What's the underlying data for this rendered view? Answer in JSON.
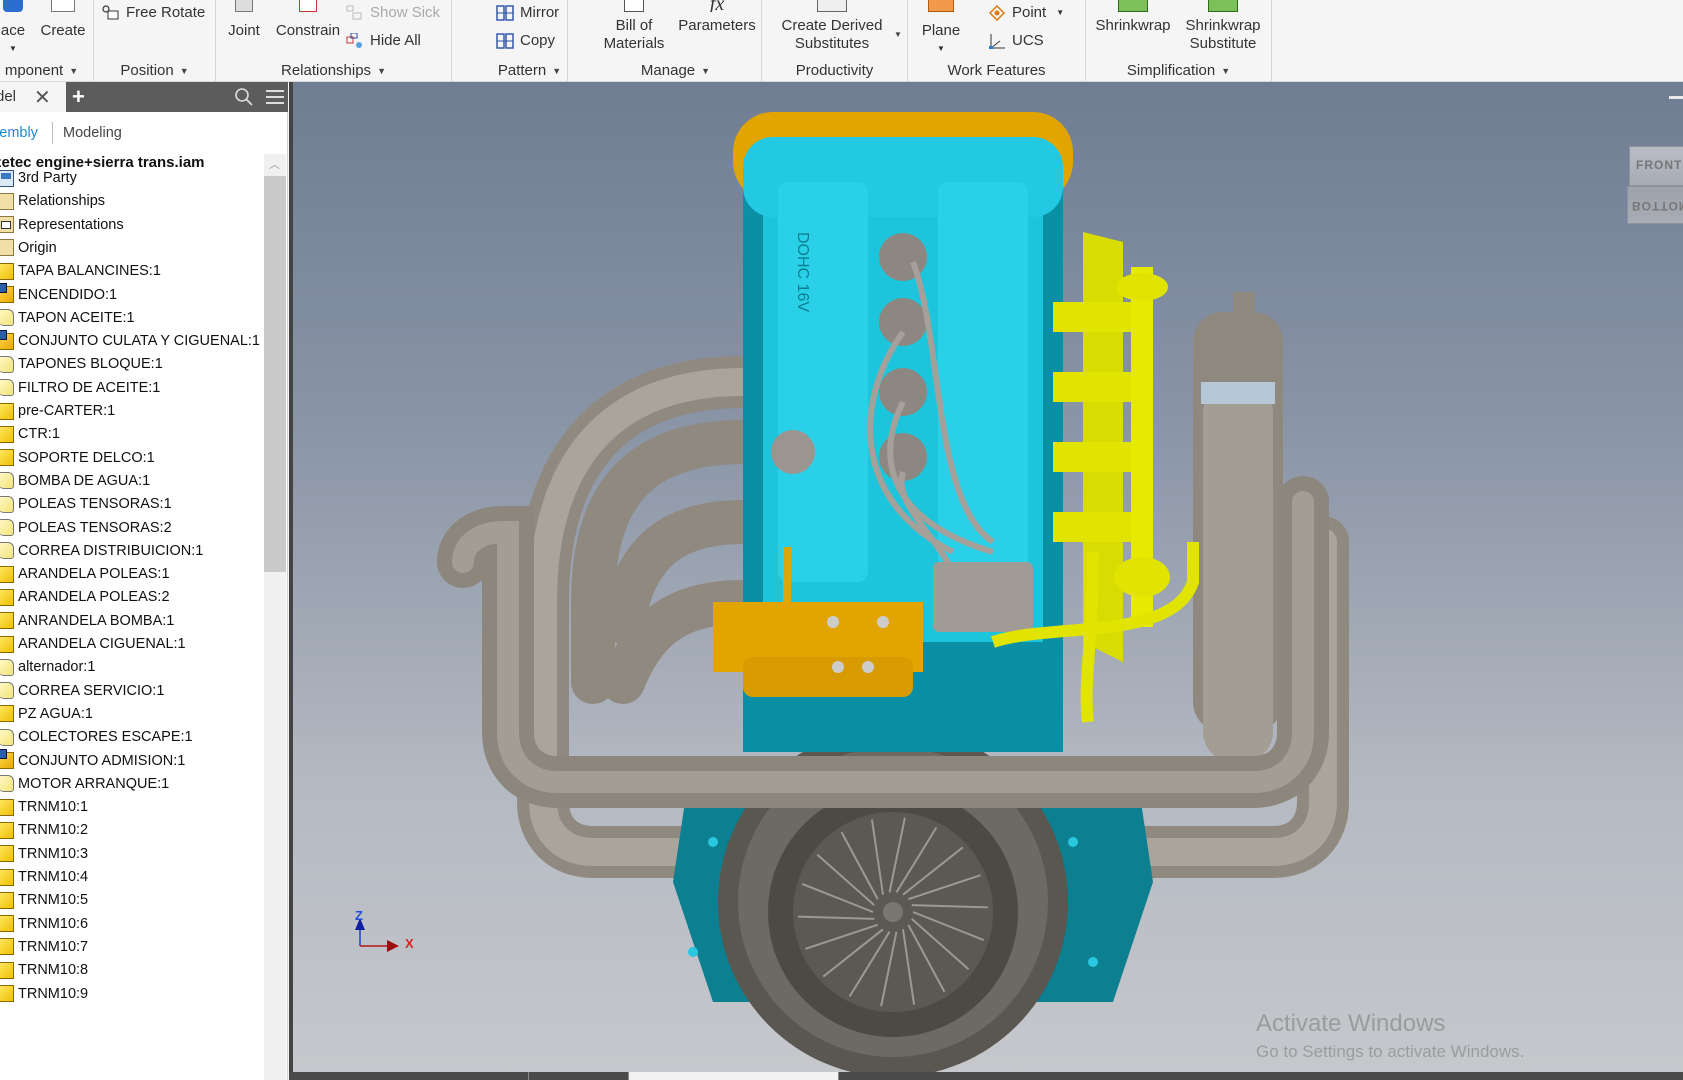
{
  "ribbon": {
    "panels": [
      {
        "title": "mponent",
        "buttons": [
          {
            "label": "ace"
          },
          {
            "label": "Create"
          }
        ]
      },
      {
        "title": "Position",
        "buttons": [
          {
            "label": "Free Rotate"
          }
        ]
      },
      {
        "title": "Relationships",
        "buttons": [
          {
            "label": "Joint"
          },
          {
            "label": "Constrain"
          },
          {
            "label": "Show Sick"
          },
          {
            "label": "Hide All"
          }
        ]
      },
      {
        "title": "Pattern",
        "buttons": [
          {
            "label": "Mirror"
          },
          {
            "label": "Copy"
          }
        ]
      },
      {
        "title": "Manage",
        "buttons": [
          {
            "label_line1": "Bill of",
            "label_line2": "Materials"
          },
          {
            "label": "Parameters"
          }
        ]
      },
      {
        "title": "Productivity",
        "buttons": [
          {
            "label_line1": "Create Derived",
            "label_line2": "Substitutes"
          }
        ]
      },
      {
        "title": "Work Features",
        "buttons": [
          {
            "label": "Plane"
          },
          {
            "label": "Point"
          },
          {
            "label": "UCS"
          }
        ]
      },
      {
        "title": "Simplification",
        "buttons": [
          {
            "label": "Shrinkwrap"
          },
          {
            "label_line1": "Shrinkwrap",
            "label_line2": "Substitute"
          }
        ]
      }
    ],
    "dropdown_glyph": "▼"
  },
  "browser": {
    "tab_label": "del",
    "close_glyph": "✕",
    "add_glyph": "+",
    "modes": {
      "assembly": "sembly",
      "modeling": "Modeling"
    },
    "root": "zetec engine+sierra trans.iam",
    "items": [
      {
        "label": "3rd Party",
        "icon": "third-party-icon"
      },
      {
        "label": "Relationships",
        "icon": "folder-icon"
      },
      {
        "label": "Representations",
        "icon": "representations-icon"
      },
      {
        "label": "Origin",
        "icon": "folder-icon"
      },
      {
        "label": "TAPA BALANCINES:1",
        "icon": "part-icon"
      },
      {
        "label": "ENCENDIDO:1",
        "icon": "subassembly-icon"
      },
      {
        "label": "TAPON ACEITE:1",
        "icon": "adaptive-part-icon"
      },
      {
        "label": "CONJUNTO CULATA Y CIGUENAL:1",
        "icon": "subassembly-icon"
      },
      {
        "label": "TAPONES BLOQUE:1",
        "icon": "adaptive-part-icon"
      },
      {
        "label": "FILTRO DE ACEITE:1",
        "icon": "adaptive-part-icon"
      },
      {
        "label": "pre-CARTER:1",
        "icon": "part-icon"
      },
      {
        "label": "CTR:1",
        "icon": "part-icon"
      },
      {
        "label": "SOPORTE DELCO:1",
        "icon": "part-icon"
      },
      {
        "label": "BOMBA DE AGUA:1",
        "icon": "adaptive-part-icon"
      },
      {
        "label": "POLEAS TENSORAS:1",
        "icon": "adaptive-part-icon"
      },
      {
        "label": "POLEAS TENSORAS:2",
        "icon": "adaptive-part-icon"
      },
      {
        "label": "CORREA DISTRIBUICION:1",
        "icon": "adaptive-part-icon"
      },
      {
        "label": "ARANDELA POLEAS:1",
        "icon": "part-icon"
      },
      {
        "label": "ARANDELA POLEAS:2",
        "icon": "part-icon"
      },
      {
        "label": "ANRANDELA BOMBA:1",
        "icon": "part-icon"
      },
      {
        "label": "ARANDELA CIGUENAL:1",
        "icon": "part-icon"
      },
      {
        "label": "alternador:1",
        "icon": "adaptive-part-icon"
      },
      {
        "label": "CORREA SERVICIO:1",
        "icon": "adaptive-part-icon"
      },
      {
        "label": "PZ AGUA:1",
        "icon": "part-icon"
      },
      {
        "label": "COLECTORES ESCAPE:1",
        "icon": "adaptive-part-icon"
      },
      {
        "label": "CONJUNTO ADMISION:1",
        "icon": "subassembly-icon"
      },
      {
        "label": "MOTOR ARRANQUE:1",
        "icon": "adaptive-part-icon"
      },
      {
        "label": "TRNM10:1",
        "icon": "part-icon"
      },
      {
        "label": "TRNM10:2",
        "icon": "part-icon"
      },
      {
        "label": "TRNM10:3",
        "icon": "part-icon"
      },
      {
        "label": "TRNM10:4",
        "icon": "part-icon"
      },
      {
        "label": "TRNM10:5",
        "icon": "part-icon"
      },
      {
        "label": "TRNM10:6",
        "icon": "part-icon"
      },
      {
        "label": "TRNM10:7",
        "icon": "part-icon"
      },
      {
        "label": "TRNM10:8",
        "icon": "part-icon"
      },
      {
        "label": "TRNM10:9",
        "icon": "part-icon"
      }
    ]
  },
  "viewport": {
    "viewcube": {
      "front": "FRONT",
      "bottom": "BOTTOM"
    },
    "triad": {
      "z": "Z",
      "x": "X"
    },
    "valve_cover_text": "DOHC 16V",
    "colors": {
      "cyan": "#1fc0d8",
      "dark_cyan": "#006a7a",
      "orange": "#e0a000",
      "yellow": "#e3e600",
      "gray": "#9c968d"
    }
  },
  "watermark": {
    "line1": "Activate Windows",
    "line2": "Go to Settings to activate Windows."
  }
}
